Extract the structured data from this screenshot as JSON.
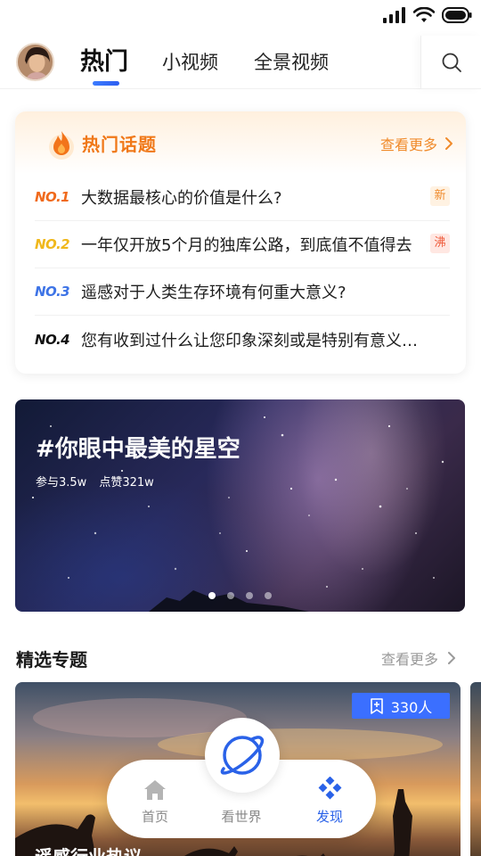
{
  "header": {
    "tabs": [
      {
        "label": "热门",
        "active": true
      },
      {
        "label": "小视频",
        "active": false
      },
      {
        "label": "全景视频",
        "active": false
      }
    ]
  },
  "hot_topics": {
    "title": "热门话题",
    "more_label": "查看更多",
    "items": [
      {
        "rank": "NO.1",
        "text": "大数据最核心的价值是什么?",
        "badge": "新"
      },
      {
        "rank": "NO.2",
        "text": "一年仅开放5个月的独库公路，到底值不值得去",
        "badge": "沸"
      },
      {
        "rank": "NO.3",
        "text": "遥感对于人类生存环境有何重大意义?",
        "badge": ""
      },
      {
        "rank": "NO.4",
        "text": "您有收到过什么让您印象深刻或是特别有意义的礼物",
        "badge": ""
      }
    ]
  },
  "banner": {
    "title": "#你眼中最美的星空",
    "participants": "参与3.5w",
    "likes": "点赞321w",
    "page_count": 4,
    "active_page": 0
  },
  "featured": {
    "title": "精选专题",
    "more_label": "查看更多",
    "card": {
      "followers": "330人",
      "caption": "遥感行业热议"
    }
  },
  "bottom_nav": {
    "items": [
      {
        "label": "首页",
        "icon": "home-icon",
        "active": false
      },
      {
        "label": "看世界",
        "icon": "planet-icon",
        "active": false
      },
      {
        "label": "发现",
        "icon": "discover-icon",
        "active": true
      }
    ]
  },
  "colors": {
    "accent": "#2a62e8",
    "hot_orange": "#f07818",
    "rank1": "#f06a1c",
    "rank2": "#f0b81c",
    "rank3": "#3e74e6",
    "rank4": "#111111"
  }
}
